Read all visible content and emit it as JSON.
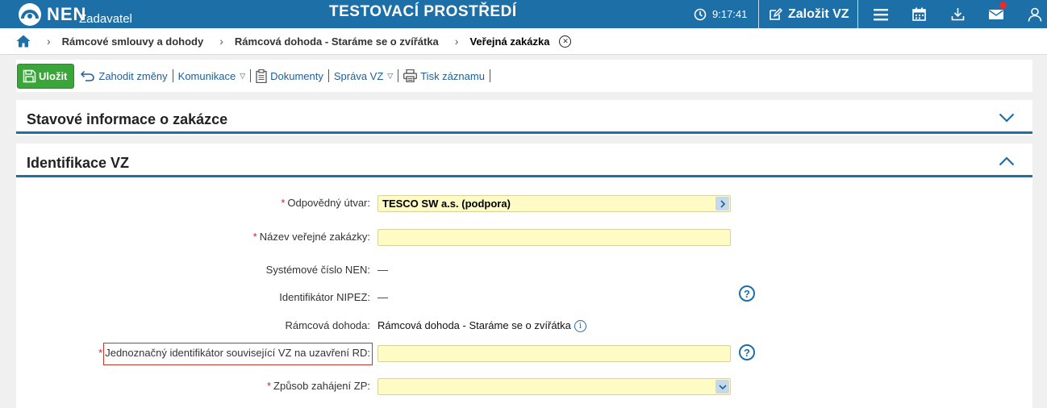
{
  "header": {
    "logo_text": "NEN",
    "logo_sub": "Zadavatel",
    "env_title": "TESTOVACÍ PROSTŘEDÍ",
    "clock": "9:17:41",
    "create_label": "Založit VZ",
    "icons": [
      "menu-icon",
      "calendar-icon",
      "download-icon",
      "mail-icon",
      "user-icon"
    ],
    "colors": {
      "bar": "#1d6fa8",
      "notification": "#e52b2b"
    }
  },
  "breadcrumb": {
    "items": [
      "Rámcové smlouvy a dohody",
      "Rámcová dohoda - Staráme se o zvířátka",
      "Veřejná zakázka"
    ]
  },
  "toolbar": {
    "save_label": "Uložit",
    "discard_label": "Zahodit změny",
    "communication_label": "Komunikace",
    "documents_label": "Dokumenty",
    "vz_admin_label": "Správa VZ",
    "print_label": "Tisk záznamu",
    "save_color": "#3aa63a"
  },
  "panels": {
    "status_title": "Stavové informace o zakázce",
    "identification_title": "Identifikace VZ"
  },
  "form": {
    "required_mark": "*",
    "responsible_unit": {
      "label": "Odpovědný útvar:",
      "value": "TESCO SW a.s. (podpora)"
    },
    "contract_name": {
      "label": "Název veřejné zakázky:",
      "value": ""
    },
    "system_number": {
      "label": "Systémové číslo NEN:",
      "value": "—"
    },
    "nipez_id": {
      "label": "Identifikátor NIPEZ:",
      "value": "—"
    },
    "framework": {
      "label": "Rámcová dohoda:",
      "value": "Rámcová dohoda - Staráme se o zvířátka"
    },
    "unique_id": {
      "label": "Jednoznačný identifikátor související VZ na uzavření RD:",
      "value": ""
    },
    "initiation": {
      "label": "Způsob zahájení ZP:",
      "value": ""
    },
    "help_glyph": "?",
    "info_glyph": "i"
  }
}
